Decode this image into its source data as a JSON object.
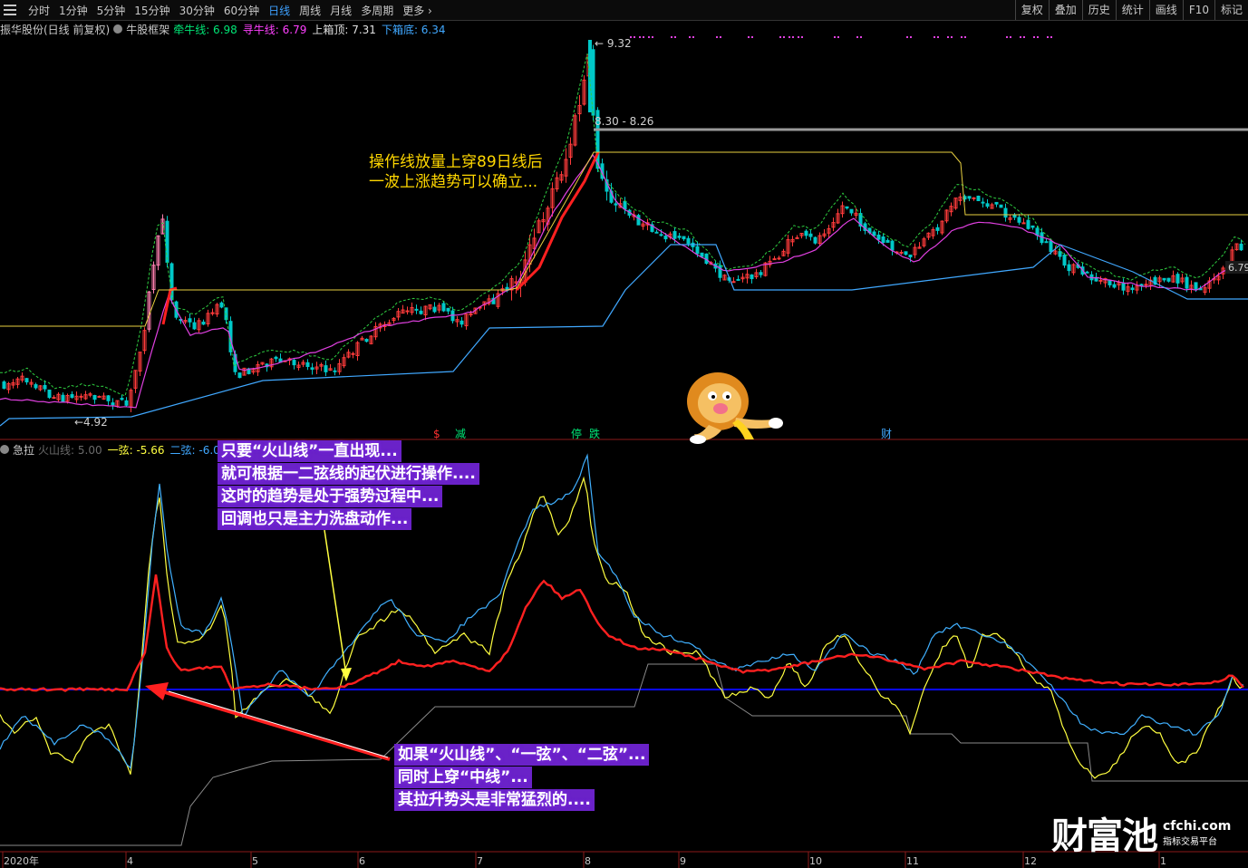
{
  "toolbar": {
    "timeframes": [
      {
        "label": "分时",
        "active": false
      },
      {
        "label": "1分钟",
        "active": false
      },
      {
        "label": "5分钟",
        "active": false
      },
      {
        "label": "15分钟",
        "active": false
      },
      {
        "label": "30分钟",
        "active": false
      },
      {
        "label": "60分钟",
        "active": false
      },
      {
        "label": "日线",
        "active": true
      },
      {
        "label": "周线",
        "active": false
      },
      {
        "label": "月线",
        "active": false
      },
      {
        "label": "多周期",
        "active": false
      },
      {
        "label": "更多",
        "active": false
      }
    ],
    "tools": [
      "复权",
      "叠加",
      "历史",
      "统计",
      "画线",
      "F10",
      "标记"
    ]
  },
  "main_panel": {
    "stock": "振华股份(日线 前复权)",
    "indicator_name": "牛股框架",
    "legend": [
      {
        "label": "牵牛线:",
        "value": "6.98",
        "color": "#00e676"
      },
      {
        "label": "寻牛线:",
        "value": "6.79",
        "color": "#ff40ff"
      },
      {
        "label": "上箱顶:",
        "value": "7.31",
        "color": "#e0e0e0"
      },
      {
        "label": "下箱底:",
        "value": "6.34",
        "color": "#40a8ff"
      }
    ],
    "price_labels": {
      "high": "9.32",
      "low": "4.92",
      "range": "8.30 - 8.26",
      "last": "6.79"
    },
    "annotation": [
      "操作线放量上穿89日线后",
      "一波上涨趋势可以确立..."
    ],
    "signals": [
      {
        "text": "$",
        "color": "#ff3030"
      },
      {
        "text": "减",
        "color": "#00e676"
      },
      {
        "text": "停",
        "color": "#00e676"
      },
      {
        "text": "跌",
        "color": "#00e676"
      },
      {
        "text": "财",
        "color": "#40a8ff"
      }
    ]
  },
  "indicator_panel": {
    "name": "急拉",
    "legend": [
      {
        "label": "火山线:",
        "value": "5.00",
        "color": "#6a6a6a"
      },
      {
        "label": "一弦:",
        "value": "-5.66",
        "color": "#ffff40"
      },
      {
        "label": "二弦:",
        "value": "-6.00",
        "color": "#40a8ff"
      }
    ],
    "note_top": [
      "只要“火山线”一直出现...",
      "就可根据一二弦线的起伏进行操作....",
      "这时的趋势是处于强势过程中...",
      "回调也只是主力洗盘动作..."
    ],
    "note_bottom": [
      "如果“火山线”、“一弦”、“二弦”...",
      "同时上穿“中线”...",
      "其拉升势头是非常猛烈的...."
    ]
  },
  "x_axis": {
    "labels": [
      "2020年",
      "4",
      "5",
      "6",
      "7",
      "8",
      "9",
      "10",
      "11",
      "12",
      "1"
    ]
  },
  "watermark": {
    "main": "财富池",
    "url": "cfchi.com",
    "sub": "指标交易平台"
  },
  "chart_data": [
    {
      "type": "line",
      "title": "振华股份(日线 前复权)",
      "series": [
        {
          "name": "牵牛线",
          "color": "#00e676"
        },
        {
          "name": "寻牛线",
          "color": "#ff40ff"
        },
        {
          "name": "上箱顶",
          "color": "#e0e0e0"
        },
        {
          "name": "下箱底",
          "color": "#40a8ff"
        }
      ],
      "ylim": [
        4.8,
        9.4
      ],
      "grid": false
    },
    {
      "type": "line",
      "title": "急拉",
      "series": [
        {
          "name": "火山线",
          "color": "#6a6a6a"
        },
        {
          "name": "一弦",
          "color": "#ffff40"
        },
        {
          "name": "二弦",
          "color": "#40a8ff"
        }
      ],
      "grid": false
    }
  ]
}
